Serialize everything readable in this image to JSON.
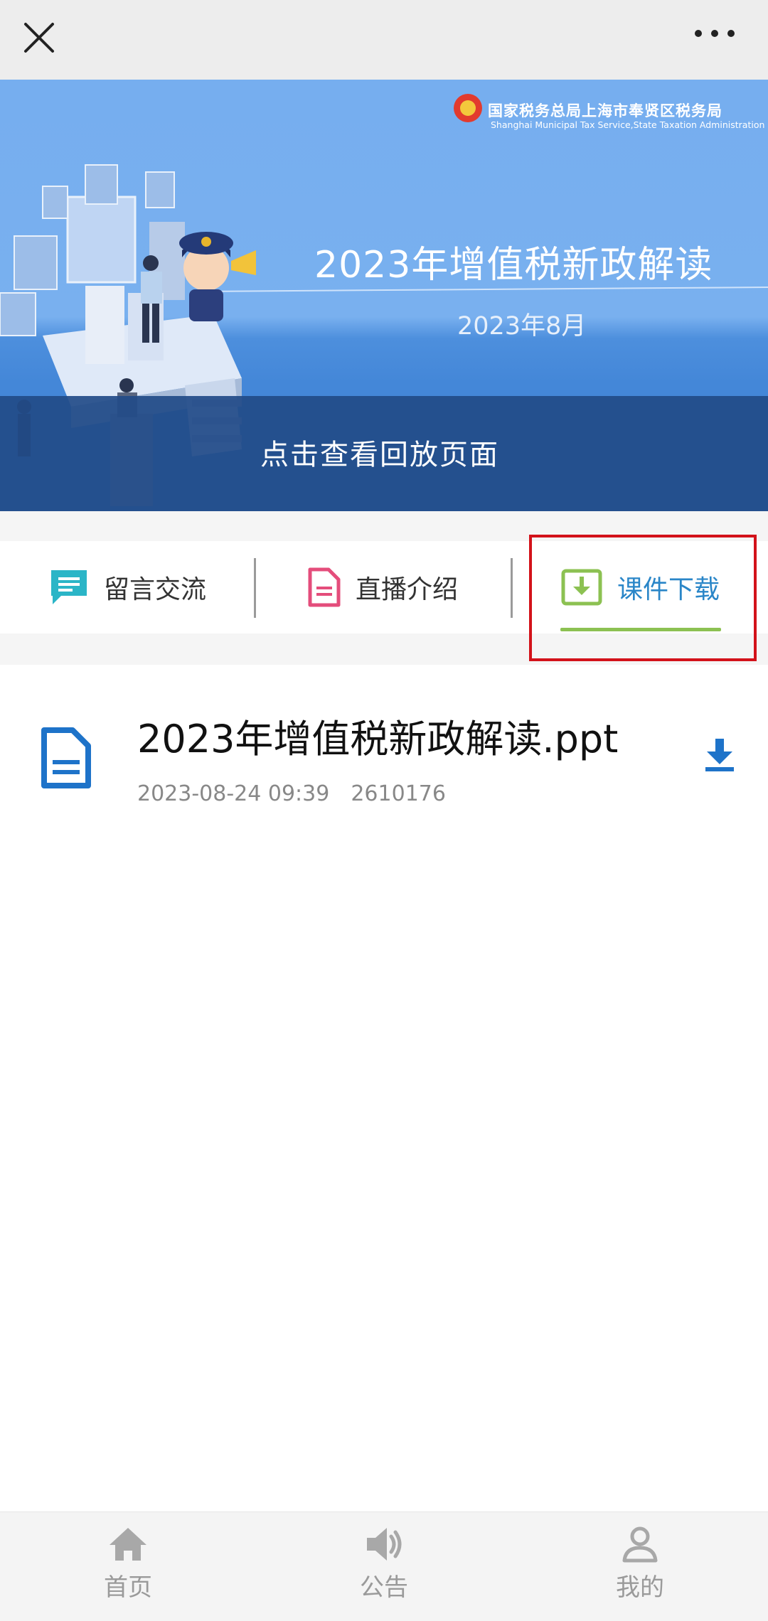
{
  "banner": {
    "org_cn": "国家税务总局上海市奉贤区税务局",
    "org_en": "Shanghai Municipal Tax Service,State Taxation Administration",
    "title": "2023年增值税新政解读",
    "date": "2023年8月",
    "play_label": "点击查看回放页面"
  },
  "tabs": [
    {
      "label": "留言交流",
      "icon": "message-icon",
      "color": "#2bb5c7"
    },
    {
      "label": "直播介绍",
      "icon": "document-icon",
      "color": "#e44d7b"
    },
    {
      "label": "课件下载",
      "icon": "download-box-icon",
      "color": "#8cc152",
      "active": true
    }
  ],
  "file": {
    "name": "2023年增值税新政解读.ppt",
    "datetime": "2023-08-24 09:39",
    "size": "2610176",
    "icon_color": "#1e73c9"
  },
  "nav": [
    {
      "label": "首页",
      "icon": "home-icon"
    },
    {
      "label": "公告",
      "icon": "speaker-icon"
    },
    {
      "label": "我的",
      "icon": "user-icon"
    }
  ],
  "colors": {
    "accent": "#2a86c8",
    "highlight_border": "#d3121a",
    "tab_underline": "#8cc152"
  }
}
